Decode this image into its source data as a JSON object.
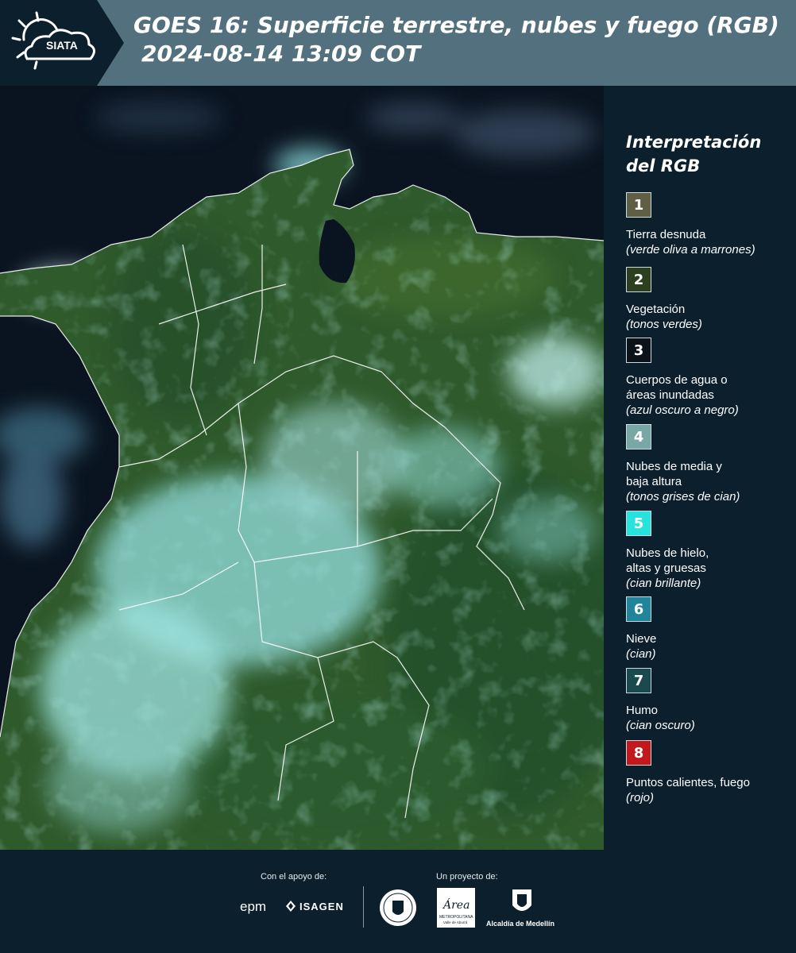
{
  "header": {
    "logo_text": "SIATA",
    "title_line1": "GOES 16: Superficie terrestre, nubes y fuego (RGB)",
    "title_line2": "2024-08-14 13:09 COT"
  },
  "colors": {
    "header_bg": "#52707d",
    "panel_bg": "#0b1f2c",
    "vegetation": "#2f5a2c",
    "ocean": "#0a1420",
    "cloud_cyan": "#7fe0e2"
  },
  "legend": {
    "title": "Interpretación del RGB",
    "items": [
      {
        "number": "1",
        "label": "Tierra desnuda",
        "desc": "(verde oliva a marrones)",
        "color": "#5f5f45"
      },
      {
        "number": "2",
        "label": "Vegetación",
        "desc": "(tonos verdes)",
        "color": "#2c4020"
      },
      {
        "number": "3",
        "label": "Cuerpos de agua o\náreas inundadas",
        "desc": "(azul oscuro a negro)",
        "color": "#0b1219"
      },
      {
        "number": "4",
        "label": "Nubes de media y\nbaja altura",
        "desc": "(tonos grises de cian)",
        "color": "#79a7a6"
      },
      {
        "number": "5",
        "label": "Nubes de hielo,\naltas y gruesas",
        "desc": "(cian brillante)",
        "color": "#27e3dd"
      },
      {
        "number": "6",
        "label": "Nieve",
        "desc": "(cian)",
        "color": "#20859a"
      },
      {
        "number": "7",
        "label": "Humo",
        "desc": "(cian oscuro)",
        "color": "#1a4a4e"
      },
      {
        "number": "8",
        "label": "Puntos calientes, fuego",
        "desc": "(rojo)",
        "color": "#c3191c"
      }
    ]
  },
  "footer": {
    "support_caption": "Con el apoyo de:",
    "project_caption": "Un proyecto de:",
    "epm_text": "epm",
    "isagen_text": "ISAGEN",
    "area_text": "Área",
    "area_sub": "METROPOLITANA",
    "area_sub2": "Valle de Aburrá",
    "alcaldia_text": "Alcaldía de Medellín"
  }
}
